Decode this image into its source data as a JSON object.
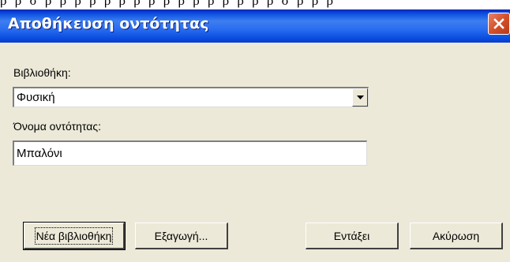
{
  "window": {
    "top_fragment": "ρ ρ σ ρ ρ ρ ρ ρ ρ ρ ρ ρ ρ ρ ρ ρ ρ ρ ρ σ ρ ρ ρ",
    "title": "Αποθήκευση οντότητας",
    "close_icon": "close-icon"
  },
  "form": {
    "library_label": "Βιβλιοθήκη:",
    "library_value": "Φυσική",
    "entity_name_label": "Όνομα οντότητας:",
    "entity_name_value": "Μπαλόνι"
  },
  "buttons": {
    "new_library": "Νέα βιβλιοθήκη",
    "export": "Εξαγωγή...",
    "ok": "Εντάξει",
    "cancel": "Ακύρωση"
  },
  "colors": {
    "titlebar": "#0a4fe0",
    "dialog_bg": "#ece9d8",
    "close_button": "#d4502a"
  }
}
